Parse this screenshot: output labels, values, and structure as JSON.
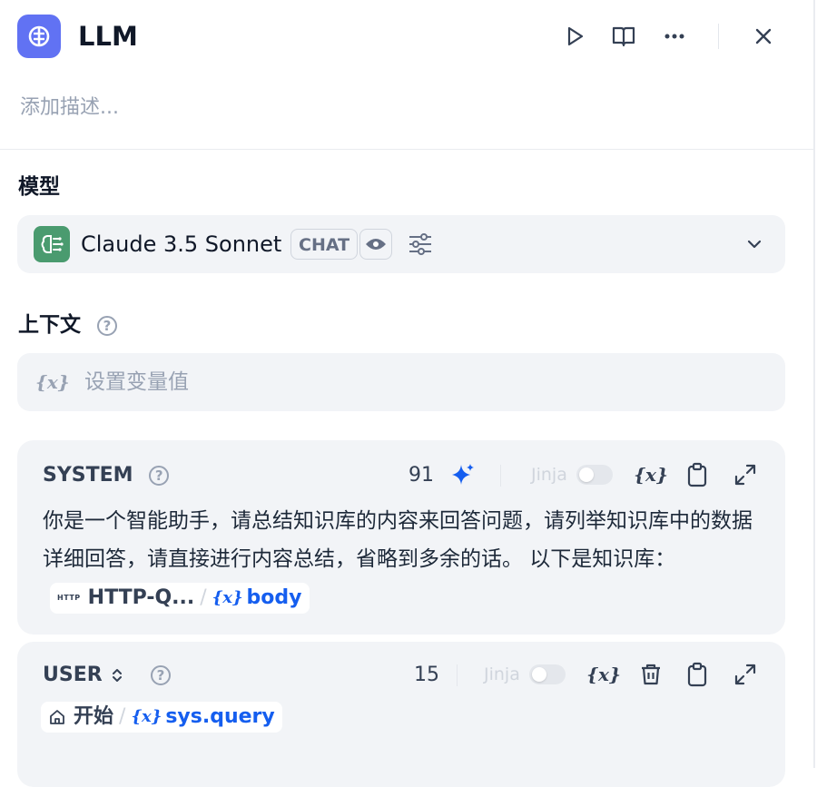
{
  "header": {
    "title": "LLM",
    "description_placeholder": "添加描述..."
  },
  "model_section": {
    "label": "模型",
    "model_name": "Claude 3.5 Sonnet",
    "mode_tag": "CHAT"
  },
  "context_section": {
    "label": "上下文",
    "help": "?",
    "var_icon": "{x}",
    "placeholder": "设置变量值"
  },
  "system_prompt": {
    "role": "SYSTEM",
    "help": "?",
    "char_count": "91",
    "jinja_label": "Jinja",
    "var_icon": "{x}",
    "text": "你是一个智能助手，请总结知识库的内容来回答问题，请列举知识库中的数据详细回答，请直接进行内容总结，省略到多余的话。 以下是知识库：",
    "chip": {
      "badge": "HTTP",
      "node": "HTTP-Q...",
      "slash": "/",
      "var_icon": "{x}",
      "var": "body"
    }
  },
  "user_prompt": {
    "role": "USER",
    "help": "?",
    "char_count": "15",
    "jinja_label": "Jinja",
    "var_icon": "{x}",
    "chip": {
      "node": "开始",
      "slash": "/",
      "var_icon": "{x}",
      "var": "sys.query"
    }
  },
  "icons": {
    "app": "brain-icon",
    "run": "play-icon",
    "docs": "book-icon",
    "more": "more-icon",
    "close": "close-icon",
    "ai": "sparkle-icon",
    "copy": "clipboard-icon",
    "expand": "expand-icon",
    "delete": "trash-icon",
    "home": "home-icon"
  },
  "colors": {
    "accent": "#6172f3",
    "variable": "#155eef",
    "model_logo": "#4a9b6f",
    "panel_bg": "#f2f4f7"
  }
}
